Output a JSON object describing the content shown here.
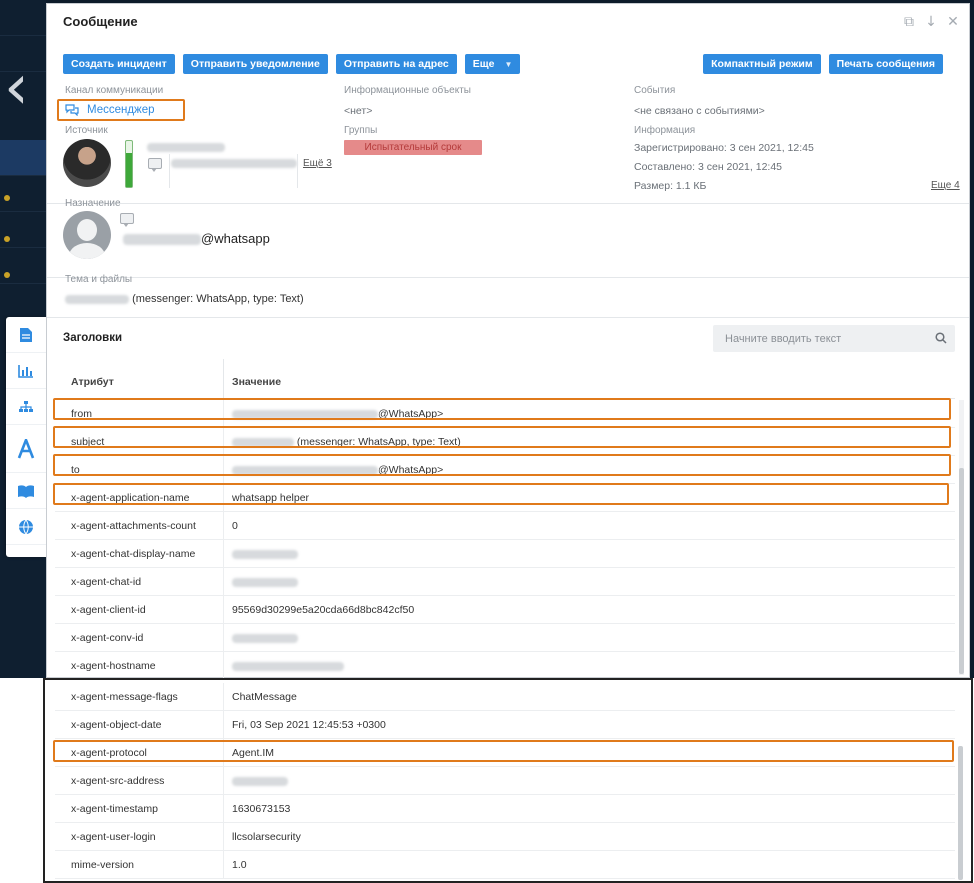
{
  "dialog": {
    "title": "Сообщение"
  },
  "toolbar": {
    "buttons": [
      "Создать инцидент",
      "Отправить уведомление",
      "Отправить на адрес",
      "Еще"
    ],
    "right_buttons": [
      "Компактный режим",
      "Печать сообщения"
    ]
  },
  "info": {
    "channel_label": "Канал коммуникации",
    "channel_value": "Мессенджер",
    "objects_label": "Информационные объекты",
    "objects_value": "<нет>",
    "events_label": "События",
    "events_value": "<не связано с событиями>",
    "source_label": "Источник",
    "source_more": "Ещё 3",
    "groups_label": "Группы",
    "groups_tag": "Испытательный срок",
    "information_label": "Информация",
    "registered": "Зарегистрировано: 3 сен 2021, 12:45",
    "composed": "Составлено: 3 сен 2021, 12:45",
    "size": "Размер: 1.1 КБ",
    "info_more": "Еще 4",
    "destination_label": "Назначение",
    "destination_suffix": "@whatsapp",
    "subject_label": "Тема и файлы",
    "subject_suffix": "(messenger: WhatsApp, type: Text)",
    "source_activity_level": 0.75
  },
  "headers": {
    "title": "Заголовки",
    "search_placeholder": "Начните вводить текст",
    "col_attribute": "Атрибут",
    "col_value": "Значение",
    "rows": [
      {
        "k": "from",
        "v": "@WhatsApp>"
      },
      {
        "k": "subject",
        "v": "(messenger: WhatsApp, type: Text)"
      },
      {
        "k": "to",
        "v": "@WhatsApp>"
      },
      {
        "k": "x-agent-application-name",
        "v": "whatsapp helper"
      },
      {
        "k": "x-agent-attachments-count",
        "v": "0"
      },
      {
        "k": "x-agent-chat-display-name",
        "v": ""
      },
      {
        "k": "x-agent-chat-id",
        "v": ""
      },
      {
        "k": "x-agent-client-id",
        "v": "95569d30299e5a20cda66d8bc842cf50"
      },
      {
        "k": "x-agent-conv-id",
        "v": ""
      },
      {
        "k": "x-agent-hostname",
        "v": ""
      }
    ],
    "rows_continued": [
      {
        "k": "x-agent-message-flags",
        "v": "ChatMessage"
      },
      {
        "k": "x-agent-object-date",
        "v": "Fri, 03 Sep 2021 12:45:53 +0300"
      },
      {
        "k": "x-agent-protocol",
        "v": "Agent.IM"
      },
      {
        "k": "x-agent-src-address",
        "v": ""
      },
      {
        "k": "x-agent-timestamp",
        "v": "1630673153"
      },
      {
        "k": "x-agent-user-login",
        "v": "llcsolarsecurity"
      },
      {
        "k": "mime-version",
        "v": "1.0"
      }
    ]
  },
  "colors": {
    "accent": "#2f8be0",
    "highlight": "#e07a1b",
    "tag_bg": "#e58a8a"
  },
  "icons": [
    "back-chevron-icon",
    "document-icon",
    "chart-icon",
    "hierarchy-icon",
    "font-a-icon",
    "book-icon",
    "globe-icon",
    "chat-bubbles-icon",
    "search-icon",
    "pin-window-icon",
    "arrow-down-icon",
    "close-icon"
  ]
}
